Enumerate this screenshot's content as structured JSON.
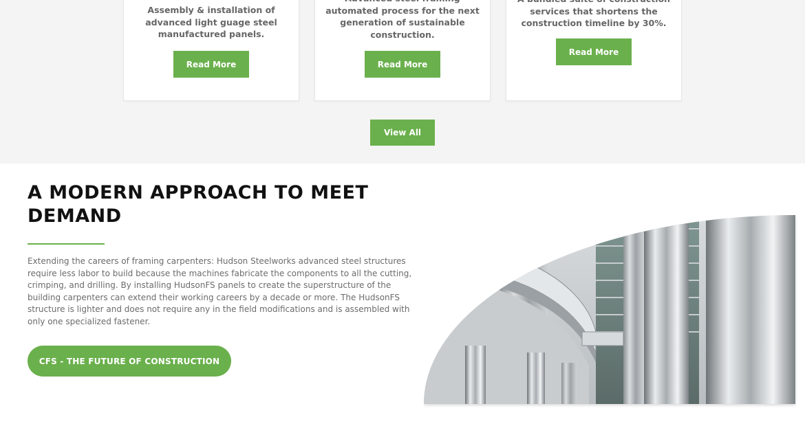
{
  "services": {
    "cards": [
      {
        "text": "Assembly & installation of\nadvanced light guage steel\nmanufactured panels.",
        "button": "Read More"
      },
      {
        "text": "Advanced steel framing\nautomated process for the next\ngeneration of sustainable\nconstruction.",
        "button": "Read More"
      },
      {
        "text": "A bundled suite of construction\nservices that shortens the\nconstruction timeline by 30%.",
        "button": "Read More"
      }
    ],
    "view_all": "View All"
  },
  "approach": {
    "heading": "A MODERN APPROACH TO MEET\nDEMAND",
    "body": "Extending the careers of framing carpenters: Hudson Steelworks advanced steel structures require less labor to build because the machines fabricate the components to all the cutting, crimping, and drilling. By installing HudsonFS panels to create the superstructure of the building carpenters can extend their working careers by a decade or more. The HudsonFS structure is lighter and does not require any in the field modifications and is assembled with only one specialized fastener.",
    "cta": "CFS - THE FUTURE OF CONSTRUCTION"
  },
  "colors": {
    "accent": "#6ab04c",
    "band": "#f4f4f4"
  }
}
